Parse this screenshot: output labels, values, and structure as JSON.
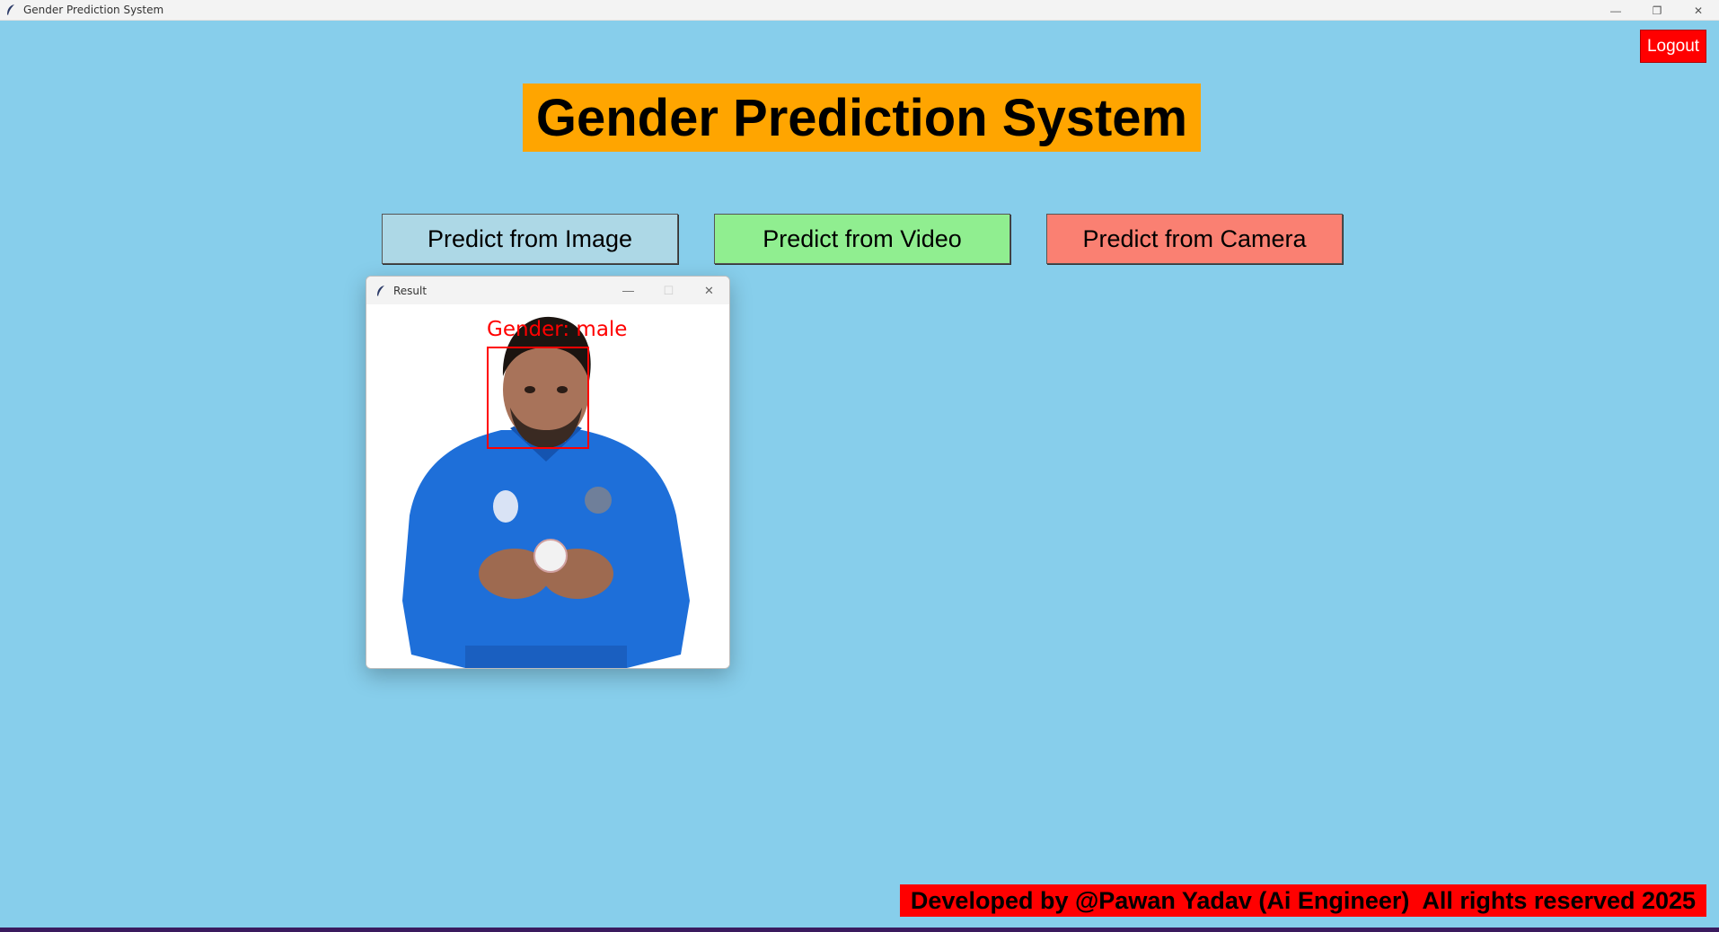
{
  "window": {
    "title": "Gender Prediction System",
    "controls": {
      "minimize": "—",
      "restore": "❐",
      "close": "✕"
    }
  },
  "header": {
    "logout_label": "Logout",
    "title": "Gender Prediction System"
  },
  "actions": {
    "image_label": "Predict from Image",
    "video_label": "Predict from Video",
    "camera_label": "Predict from Camera"
  },
  "result_window": {
    "title": "Result",
    "controls": {
      "minimize": "—",
      "maximize": "☐",
      "close": "✕"
    },
    "prediction_label": "Gender: male"
  },
  "footer": {
    "text": "Developed by @Pawan Yadav (Ai Engineer)  All rights reserved 2025"
  },
  "colors": {
    "background": "#87ceeb",
    "title_bg": "#ffa500",
    "image_btn": "#add8e6",
    "video_btn": "#90ee90",
    "camera_btn": "#fa8072",
    "logout_bg": "#ff0000",
    "footer_bg": "#ff0000",
    "annotation": "#ff0000"
  },
  "icons": {
    "app_icon": "feather-icon",
    "result_icon": "feather-icon"
  }
}
